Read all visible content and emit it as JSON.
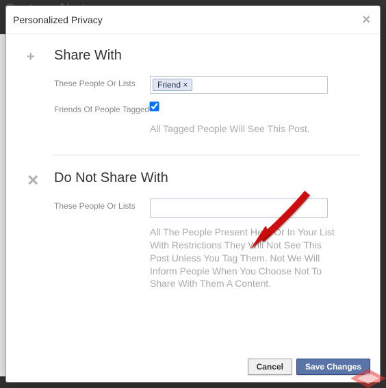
{
  "background": {
    "profile_name": "Gaetano Abatemarco"
  },
  "modal": {
    "title": "Personalized Privacy",
    "share": {
      "heading": "Share With",
      "people_label": "These People Or Lists",
      "friend_token": "Friend ×",
      "friends_tagged_label": "Friends Of People Tagged",
      "info": "All Tagged People Will See This Post."
    },
    "not_share": {
      "heading": "Do Not Share With",
      "people_label": "These People Or Lists",
      "info": "All The People Present Here Or In Your List With Restrictions They Will Not See This Post Unless You Tag Them. Not We Will Inform People When You Choose Not To Share With Them A Content."
    },
    "footer": {
      "cancel": "Cancel",
      "save": "Save Changes"
    }
  }
}
